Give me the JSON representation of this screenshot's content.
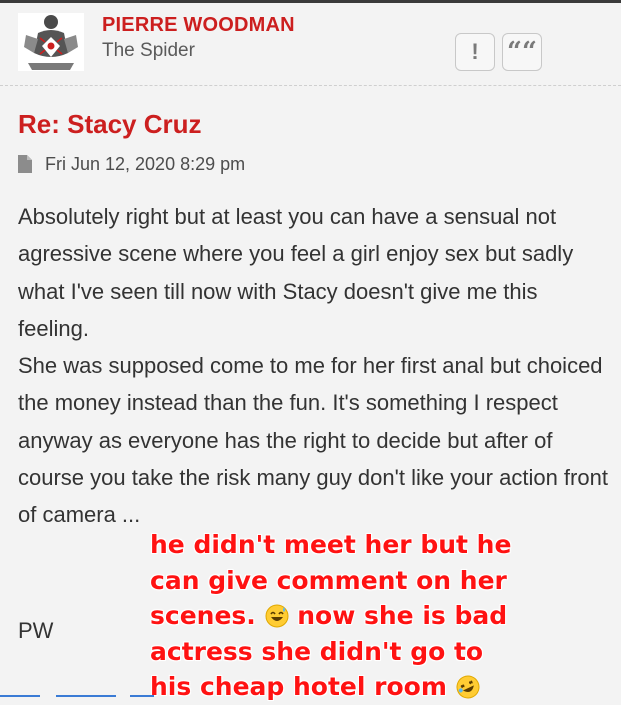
{
  "author": {
    "name": "PIERRE WOODMAN",
    "rank": "The Spider"
  },
  "actions": {
    "report_label": "!",
    "quote_label": "““"
  },
  "post": {
    "title": "Re: Stacy Cruz",
    "date": "Fri Jun 12, 2020 8:29 pm",
    "paragraph1": "Absolutely right but at least you can have a sensual not agressive scene where you feel a girl enjoy sex but sadly what I've seen till now with Stacy doesn't give me this feeling.",
    "paragraph2": "She was supposed come to me for her first anal but choiced the money instead than the fun. It's something I respect anyway as everyone has the right to decide but after of course you take the risk many guy don't like your action front of camera ...",
    "signature": "PW"
  },
  "overlay": {
    "line1": "he didn't meet her but he",
    "line2": "can give comment on her",
    "line3_a": "scenes.",
    "line3_b": "now she is bad",
    "line4": "actress she didn't go to",
    "line5": "his cheap hotel room"
  },
  "colors": {
    "accent": "#cc1f1f",
    "overlay_text": "#ff1212",
    "background": "#f3f3f3",
    "body_text": "#333333"
  },
  "icons": [
    "avatar-spider-logo",
    "file-icon",
    "exclamation-icon",
    "quote-icon",
    "grinning-sweat-emoji",
    "rofl-emoji"
  ]
}
